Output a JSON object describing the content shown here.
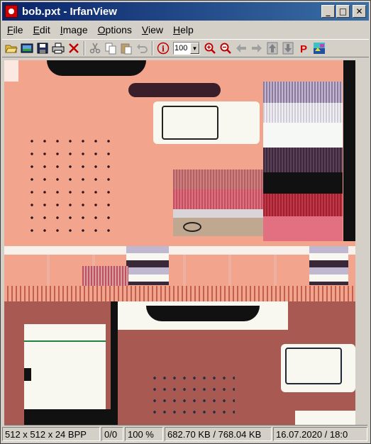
{
  "window": {
    "title": "bob.pxt - IrfanView",
    "minimize": "_",
    "maximize": "□",
    "close": "✕"
  },
  "menu": {
    "items": [
      {
        "label": "File",
        "u": "F",
        "rest": "ile"
      },
      {
        "label": "Edit",
        "u": "E",
        "rest": "dit"
      },
      {
        "label": "Image",
        "u": "I",
        "rest": "mage"
      },
      {
        "label": "Options",
        "u": "O",
        "rest": "ptions"
      },
      {
        "label": "View",
        "u": "V",
        "rest": "iew"
      },
      {
        "label": "Help",
        "u": "H",
        "rest": "elp"
      }
    ]
  },
  "toolbar": {
    "zoom_value": "100",
    "icons": [
      "open-folder-icon",
      "thumbnails-icon",
      "save-icon",
      "print-icon",
      "delete-icon",
      "cut-icon",
      "copy-icon",
      "paste-icon",
      "undo-icon",
      "info-icon",
      "zoom-in-icon",
      "zoom-out-icon",
      "previous-icon",
      "next-icon",
      "first-icon",
      "last-icon",
      "paint-icon",
      "color-correction-icon"
    ],
    "paint_label": "P",
    "info_label": "i"
  },
  "status": {
    "dimensions": "512 x 512 x 24 BPP",
    "index": "0/0",
    "zoom": "100 %",
    "filesize": "682.70 KB / 768.04 KB",
    "datetime": "16.07.2020 / 18:0"
  },
  "colors": {
    "titlebar_start": "#0a246a",
    "titlebar_end": "#3a6ea5",
    "canvas_salmon": "#f2a58c",
    "canvas_brown": "#a85a52",
    "canvas_pink": "#e27080",
    "canvas_crimson": "#b03040"
  }
}
